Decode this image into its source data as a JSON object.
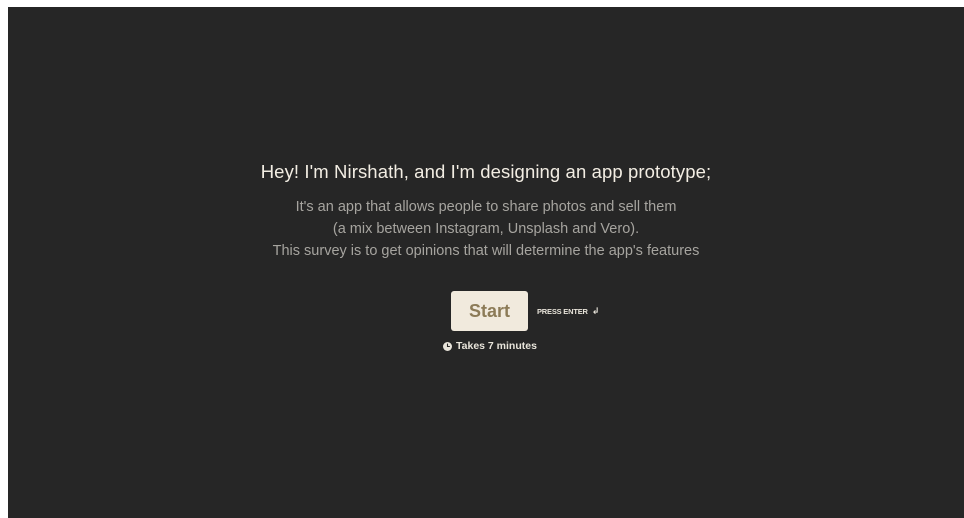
{
  "welcome": {
    "title": "Hey! I'm Nirshath, and I'm designing an app prototype;",
    "description_lines": [
      "It's an app that allows people to share photos and sell them",
      "(a mix between Instagram, Unsplash and Vero).",
      "This survey is to get opinions that will determine the app's features"
    ]
  },
  "actions": {
    "start_label": "Start",
    "press_enter_label": "PRESS ENTER",
    "enter_icon": "enter-icon"
  },
  "duration": {
    "icon": "clock-icon",
    "label": "Takes 7 minutes"
  },
  "colors": {
    "background": "#262626",
    "title": "#f2ede3",
    "description": "#a6a49f",
    "button_bg": "#f1eadd",
    "button_text": "#8c7b57"
  }
}
